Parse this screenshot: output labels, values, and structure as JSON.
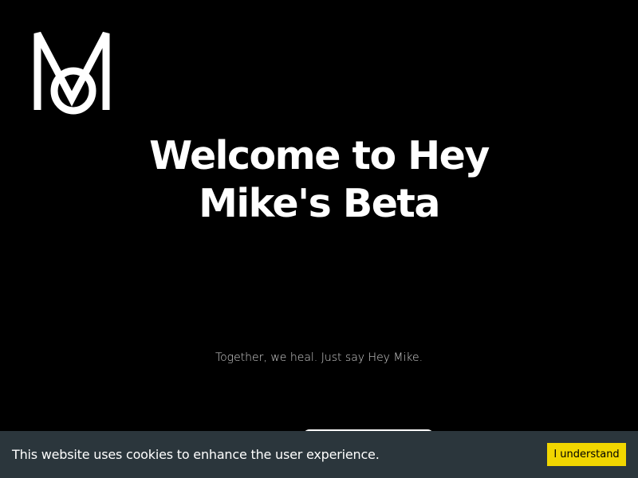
{
  "brand": {
    "logo_icon": "mo-monogram-logo-icon",
    "logo_color": "#ffffff"
  },
  "hero": {
    "title": "Welcome to Hey Mike's Beta",
    "tagline": "Together, we heal. Just say Hey Mike."
  },
  "cookie_banner": {
    "message": "This website uses cookies to enhance the user experience.",
    "accept_label": "I understand",
    "accent_color": "#f1d600",
    "background_color": "#2b363c"
  },
  "colors": {
    "page_background": "#000000",
    "text": "#ffffff"
  }
}
